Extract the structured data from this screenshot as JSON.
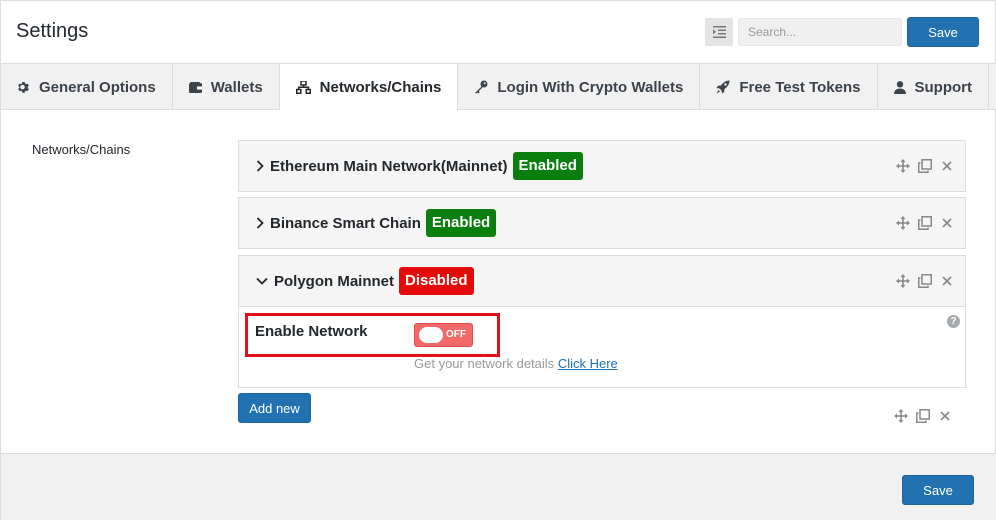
{
  "header": {
    "title": "Settings",
    "search_placeholder": "Search...",
    "save_label": "Save"
  },
  "tabs": [
    {
      "label": "General Options",
      "icon": "gear-icon"
    },
    {
      "label": "Wallets",
      "icon": "wallet-icon"
    },
    {
      "label": "Networks/Chains",
      "icon": "sitemap-icon",
      "active": true
    },
    {
      "label": "Login With Crypto Wallets",
      "icon": "key-icon"
    },
    {
      "label": "Free Test Tokens",
      "icon": "rocket-icon"
    },
    {
      "label": "Support",
      "icon": "user-icon"
    }
  ],
  "section": {
    "label": "Networks/Chains",
    "networks": [
      {
        "name": "Ethereum Main Network(Mainnet)",
        "status": "Enabled",
        "expanded": false
      },
      {
        "name": "Binance Smart Chain",
        "status": "Enabled",
        "expanded": false
      },
      {
        "name": "Polygon Mainnet",
        "status": "Disabled",
        "expanded": true
      }
    ],
    "expanded": {
      "field_label": "Enable Network",
      "toggle_state": "OFF",
      "help_text": "Get your network details",
      "help_link": "Click Here",
      "help_icon": "?"
    },
    "add_new_label": "Add new"
  },
  "footer": {
    "save_label": "Save"
  },
  "colors": {
    "primary": "#2271b1",
    "enabled": "#0a7f0f",
    "disabled": "#e60b0b",
    "toggle_off": "#f06a6a",
    "highlight": "#e3101a"
  }
}
